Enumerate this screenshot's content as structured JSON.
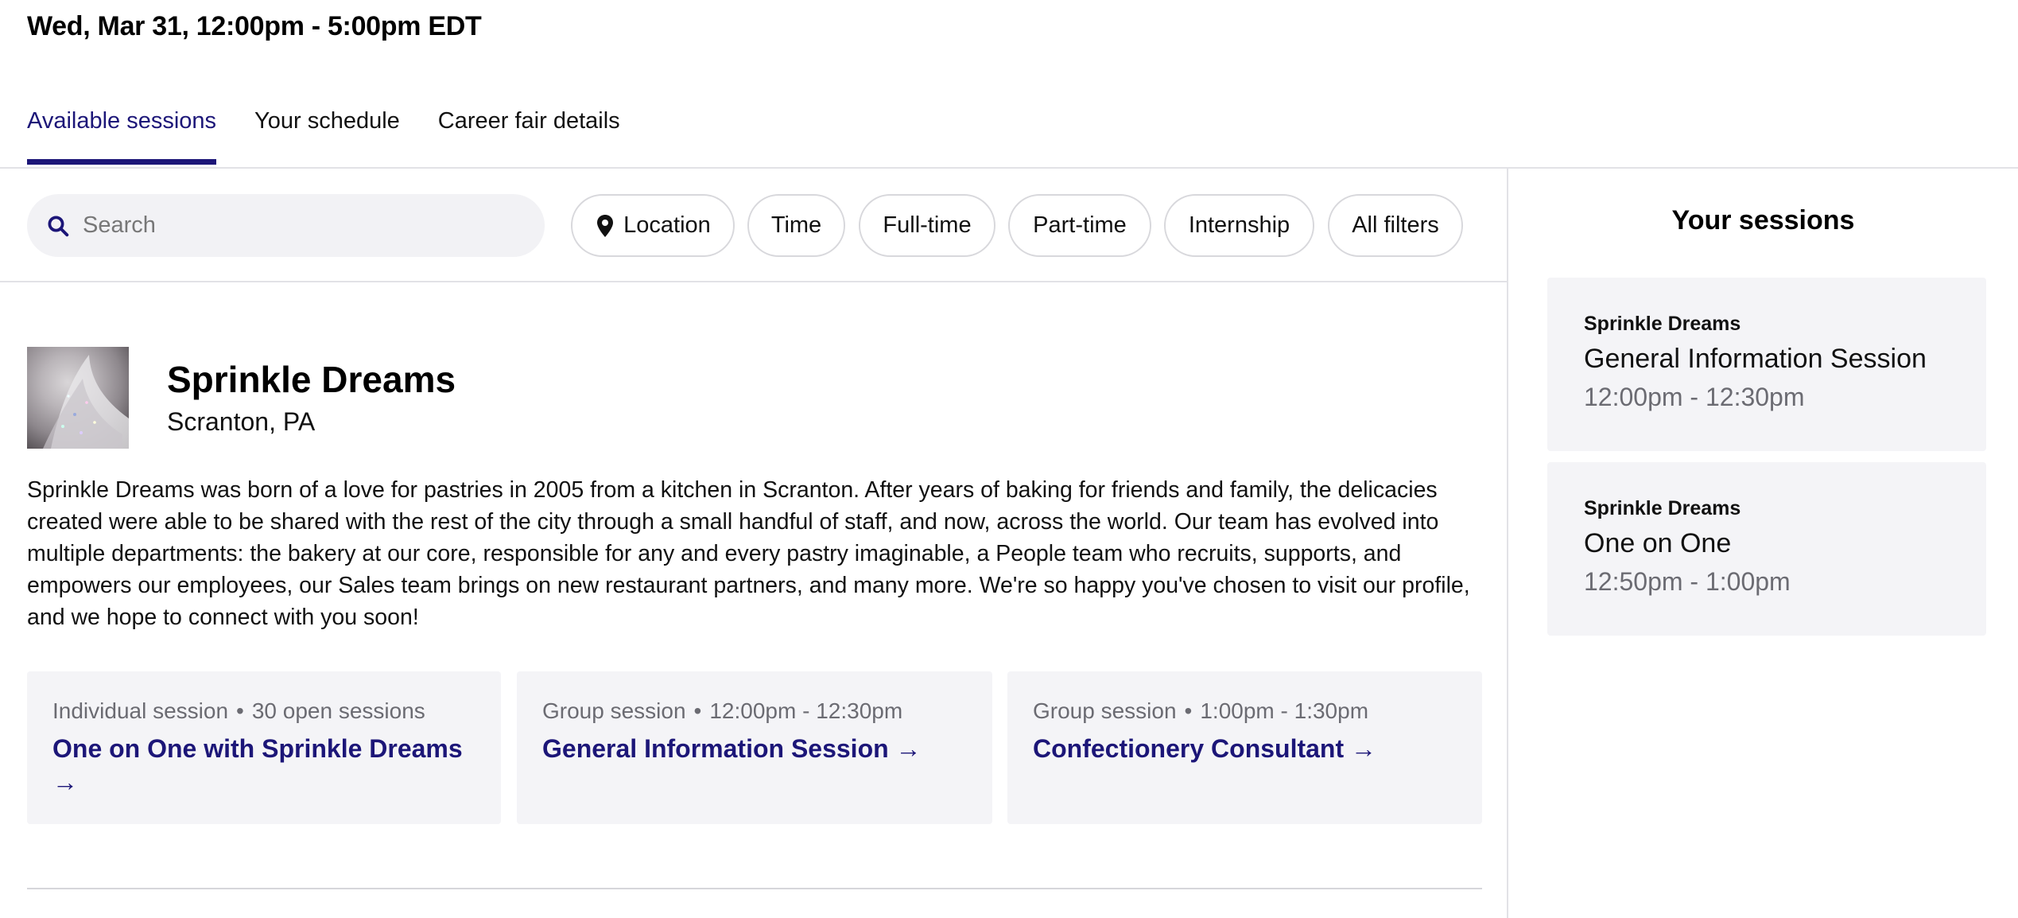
{
  "header": {
    "date_time": "Wed, Mar 31, 12:00pm - 5:00pm EDT"
  },
  "tabs": [
    {
      "label": "Available sessions",
      "active": true
    },
    {
      "label": "Your schedule",
      "active": false
    },
    {
      "label": "Career fair details",
      "active": false
    }
  ],
  "search": {
    "placeholder": "Search",
    "value": ""
  },
  "filters": [
    "Location",
    "Time",
    "Full-time",
    "Part-time",
    "Internship",
    "All filters"
  ],
  "company": {
    "name": "Sprinkle Dreams",
    "location": "Scranton, PA",
    "description": "Sprinkle Dreams was born of a love for pastries in 2005 from a kitchen in Scranton. After years of baking for friends and family, the delicacies created were able to be shared with the rest of the city through a small handful of staff, and now, across the world. Our team has evolved into multiple departments: the bakery at our core, responsible for any and every pastry imaginable, a People team who recruits, supports, and empowers our employees, our Sales team brings on new restaurant partners, and many more. We're so happy you've chosen to visit our profile, and we hope to connect with you soon!"
  },
  "session_cards": [
    {
      "type": "Individual session",
      "detail": "30 open sessions",
      "title": "One on One with Sprinkle Dreams →"
    },
    {
      "type": "Group session",
      "detail": "12:00pm - 12:30pm",
      "title": "General Information Session →"
    },
    {
      "type": "Group session",
      "detail": "1:00pm - 1:30pm",
      "title": "Confectionery Consultant →"
    }
  ],
  "sidebar": {
    "title": "Your sessions",
    "sessions": [
      {
        "company": "Sprinkle Dreams",
        "session": "General Information Session",
        "time": "12:00pm - 12:30pm"
      },
      {
        "company": "Sprinkle Dreams",
        "session": "One on One",
        "time": "12:50pm - 1:00pm"
      }
    ]
  },
  "colors": {
    "accent": "#1c1678",
    "muted_text": "#6b6b72",
    "card_bg": "#f4f4f7",
    "divider": "#e2e2e6"
  },
  "icons": {
    "search": "search-icon",
    "location": "location-pin-icon"
  }
}
